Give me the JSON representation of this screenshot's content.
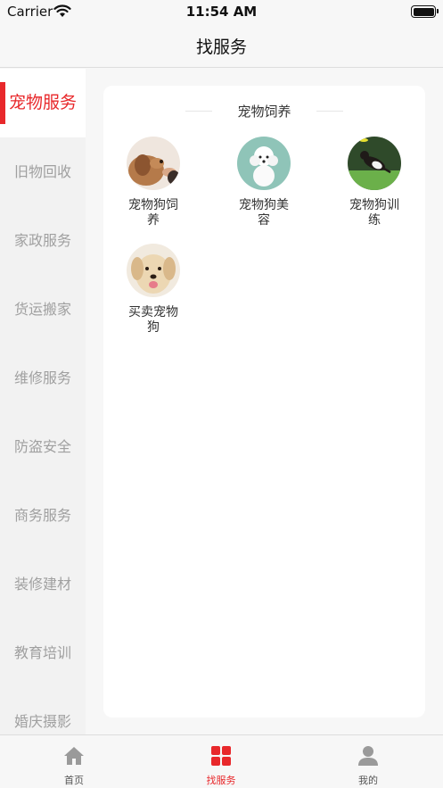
{
  "status_bar": {
    "carrier": "Carrier",
    "time": "11:54 AM"
  },
  "nav": {
    "title": "找服务"
  },
  "sidebar": {
    "items": [
      {
        "label": "宠物服务",
        "active": true
      },
      {
        "label": "旧物回收"
      },
      {
        "label": "家政服务"
      },
      {
        "label": "货运搬家"
      },
      {
        "label": "维修服务"
      },
      {
        "label": "防盗安全"
      },
      {
        "label": "商务服务"
      },
      {
        "label": "装修建材"
      },
      {
        "label": "教育培训"
      },
      {
        "label": "婚庆摄影"
      }
    ]
  },
  "section": {
    "title": "宠物饲养",
    "services": [
      {
        "label": "宠物狗饲养",
        "icon": "dog-feeding-photo"
      },
      {
        "label": "宠物狗美容",
        "icon": "poodle-grooming-photo"
      },
      {
        "label": "宠物狗训练",
        "icon": "dog-training-photo"
      },
      {
        "label": "买卖宠物狗",
        "icon": "puppy-trade-photo"
      }
    ]
  },
  "tab_bar": {
    "tabs": [
      {
        "label": "首页",
        "icon": "home-icon"
      },
      {
        "label": "找服务",
        "icon": "grid-icon",
        "active": true
      },
      {
        "label": "我的",
        "icon": "user-icon"
      }
    ]
  },
  "colors": {
    "accent": "#e8282b",
    "inactive_text": "#a0a0a0",
    "background": "#f7f7f7"
  }
}
